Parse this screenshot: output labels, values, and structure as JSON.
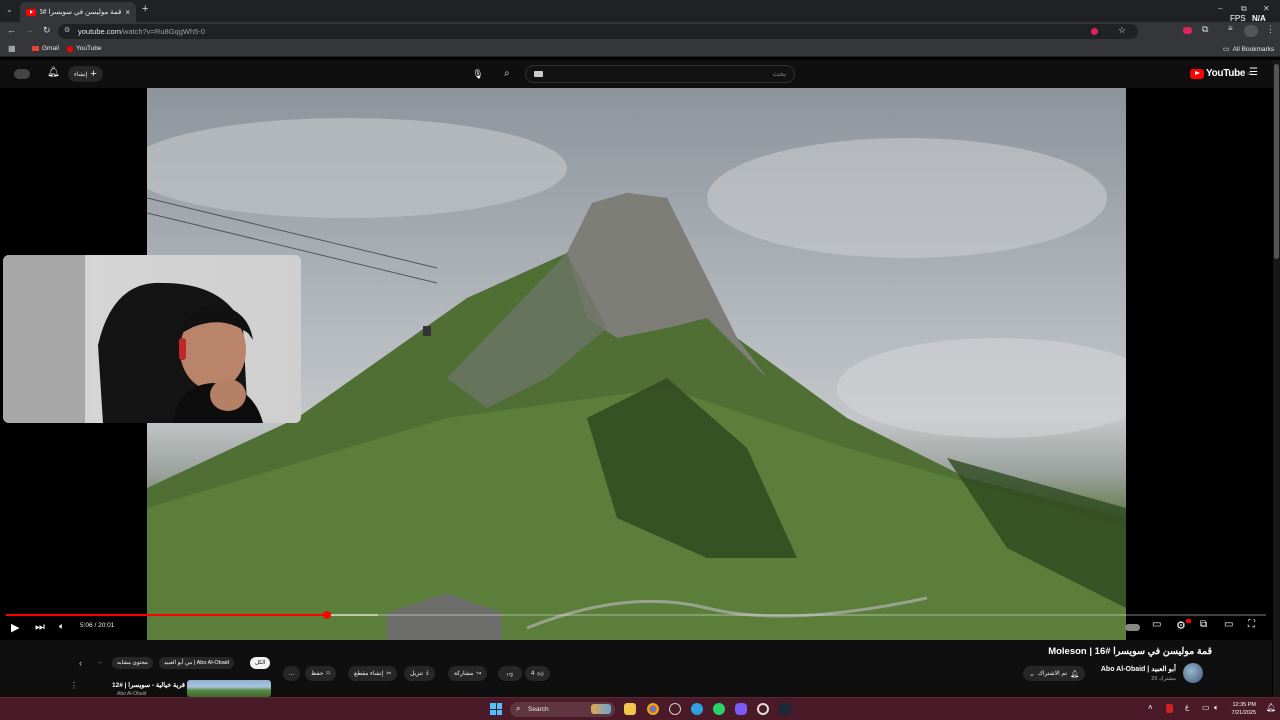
{
  "browser": {
    "tab_title": "قمة موليسن في سويسرا #16 | ج",
    "url_main": "youtube.com",
    "url_rest": "/watch?v=Ru8GqgWh5-0",
    "bookmarks": [
      "Gmail",
      "YouTube"
    ],
    "all_bookmarks": "All Bookmarks",
    "fps_label": "FPS",
    "fps_value": "N/A"
  },
  "yt_header": {
    "create_label": "إنشاء",
    "search_placeholder": "بحث",
    "logo_text": "YouTube",
    "logo_region": "SA"
  },
  "player": {
    "current_time": "5:06",
    "duration": "20:01",
    "progress_fraction": 0.255,
    "buffer_fraction": 0.295
  },
  "video": {
    "title": "قمة موليسن في سويسرا #16 | Moleson",
    "channel_name": "Abo Al-Obaid | أبو العبيد",
    "subscribers": "29 مشترك",
    "subscribed_label": "تم الاشتراك",
    "like_count": "4",
    "share_label": "مشاركة",
    "download_label": "تنزيل",
    "clip_label": "إنشاء مقطع",
    "save_label": "حفظ",
    "more_label": "..."
  },
  "filter_chips": [
    "الكل",
    "من أبو العبيد | Abo Al-Obaid",
    "محتوى مشابه"
  ],
  "recommended": {
    "title": "قرية خيالية - سويسرا | #12",
    "channel": "Abo Al-Obaid"
  },
  "taskbar": {
    "search_label": "Search",
    "time": "12:35 PM",
    "date": "7/21/2025",
    "lang": "ع"
  },
  "colors": {
    "youtube_red": "#ff0000",
    "taskbar": "#4a1a28"
  }
}
